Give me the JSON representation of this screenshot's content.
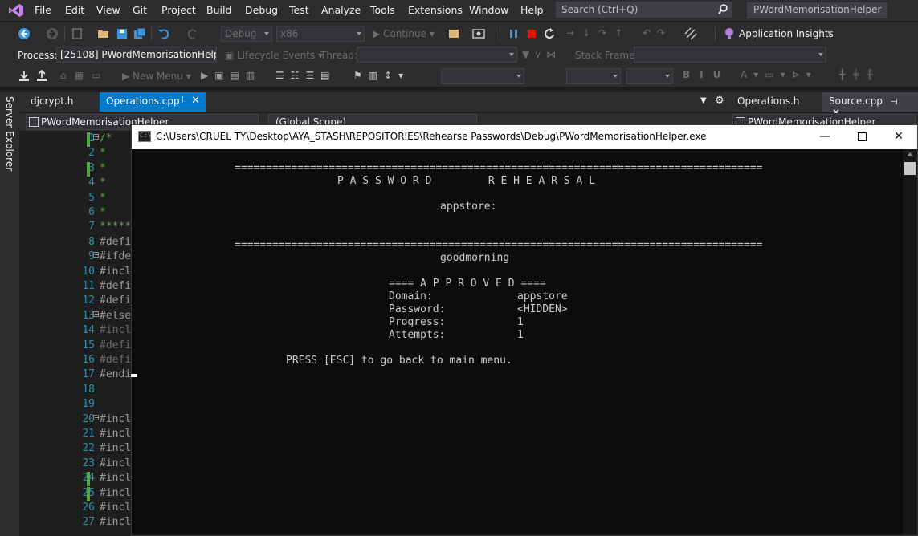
{
  "menu": [
    "File",
    "Edit",
    "View",
    "Git",
    "Project",
    "Build",
    "Debug",
    "Test",
    "Analyze",
    "Tools",
    "Extensions",
    "Window",
    "Help"
  ],
  "search": {
    "placeholder": "Search (Ctrl+Q)"
  },
  "solution_name": "PWordMemorisationHelper",
  "toolbar1": {
    "config": "Debug",
    "platform": "x86",
    "continue": "Continue",
    "app_insights": "Application Insights"
  },
  "toolbar2": {
    "process_label": "Process:",
    "process_value": "[25108] PWordMemorisationHelpe",
    "lifecycle": "Lifecycle Events",
    "thread_label": "Thread:",
    "stack_label": "Stack Frame:"
  },
  "toolbar3": {
    "new_menu": "New Menu"
  },
  "side_panel": "Server Explorer",
  "tabs": [
    {
      "label": "djcrypt.h"
    },
    {
      "label": "Operations.cpp"
    }
  ],
  "nav": {
    "project": "PWordMemorisationHelper",
    "scope": "(Global Scope)"
  },
  "right_tabs": [
    {
      "label": "Operations.h"
    },
    {
      "label": "Source.cpp"
    }
  ],
  "right_nav": "PWordMemorisationHelper",
  "editor": {
    "lines": [
      {
        "n": "1",
        "t": "/*",
        "k": "comment"
      },
      {
        "n": "2",
        "t": "*",
        "k": "comment"
      },
      {
        "n": "3",
        "t": "*",
        "k": "comment"
      },
      {
        "n": "4",
        "t": "*",
        "k": "comment"
      },
      {
        "n": "5",
        "t": "*",
        "k": "comment"
      },
      {
        "n": "6",
        "t": "*",
        "k": "comment"
      },
      {
        "n": "7",
        "t": "*****",
        "k": "comment"
      },
      {
        "n": "8",
        "t": "#defi",
        "k": "code"
      },
      {
        "n": "9",
        "t": "#ifde",
        "k": "code"
      },
      {
        "n": "10",
        "t": "#incl",
        "k": "code"
      },
      {
        "n": "11",
        "t": "#defi",
        "k": "code"
      },
      {
        "n": "12",
        "t": "#defi",
        "k": "code"
      },
      {
        "n": "13",
        "t": "#else",
        "k": "code"
      },
      {
        "n": "14",
        "t": "#incl",
        "k": "dim"
      },
      {
        "n": "15",
        "t": "#defi",
        "k": "dim"
      },
      {
        "n": "16",
        "t": "#defi",
        "k": "dim"
      },
      {
        "n": "17",
        "t": "#endi",
        "k": "code"
      },
      {
        "n": "18",
        "t": "",
        "k": "code"
      },
      {
        "n": "19",
        "t": "",
        "k": "code"
      },
      {
        "n": "20",
        "t": "#incl",
        "k": "code"
      },
      {
        "n": "21",
        "t": "#incl",
        "k": "code"
      },
      {
        "n": "22",
        "t": "#incl",
        "k": "code"
      },
      {
        "n": "23",
        "t": "#incl",
        "k": "code"
      },
      {
        "n": "24",
        "t": "#incl",
        "k": "code"
      },
      {
        "n": "25",
        "t": "#incl",
        "k": "code"
      },
      {
        "n": "26",
        "t": "#incl",
        "k": "code"
      },
      {
        "n": "27",
        "t": "#incl",
        "k": "code"
      }
    ]
  },
  "console": {
    "title": "C:\\Users\\CRUEL TY\\Desktop\\AYA_STASH\\REPOSITORIES\\Rehearse Passwords\\Debug\\PWordMemorisationHelper.exe",
    "rule": "====================================================================================",
    "heading": "P A S S W O R D         R E H E A R S A L",
    "domain_prompt": "appstore:",
    "typed": "goodmorning",
    "approved": "==== A P P R O V E D ====",
    "fields": [
      {
        "label": "Domain:",
        "value": "appstore"
      },
      {
        "label": "Password:",
        "value": "<HIDDEN>"
      },
      {
        "label": "Progress:",
        "value": "1"
      },
      {
        "label": "Attempts:",
        "value": "1"
      }
    ],
    "footer": "PRESS [ESC] to go back to main menu."
  }
}
